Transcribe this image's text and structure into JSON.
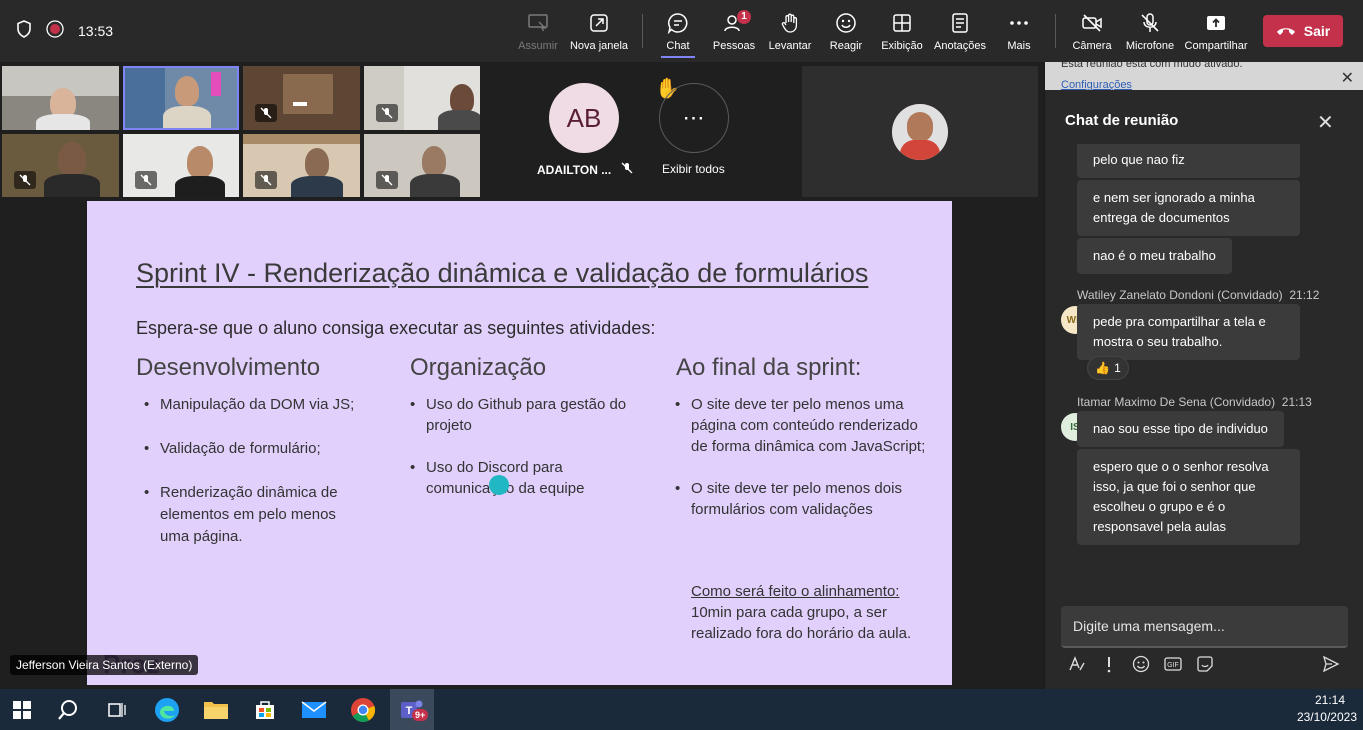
{
  "topbar": {
    "time": "13:53",
    "buttons": {
      "assumir": "Assumir",
      "nova_janela": "Nova janela",
      "chat": "Chat",
      "pessoas": "Pessoas",
      "pessoas_badge": "1",
      "levantar": "Levantar",
      "reagir": "Reagir",
      "exibicao": "Exibição",
      "anotacoes": "Anotações",
      "mais": "Mais",
      "camera": "Câmera",
      "microfone": "Microfone",
      "compartilhar": "Compartilhar",
      "sair": "Sair"
    }
  },
  "participants": {
    "ab_initials": "AB",
    "ab_name": "ADAILTON ...",
    "show_all": "Exibir todos"
  },
  "slide": {
    "title": "Sprint IV - Renderização dinâmica e validação de formulários",
    "intro": "Espera-se que o aluno consiga executar as seguintes atividades:",
    "col1": {
      "heading": "Desenvolvimento",
      "items": [
        "Manipulação da DOM via JS;",
        "Validação de formulário;",
        "Renderização dinâmica de elementos em pelo menos uma página."
      ]
    },
    "col2": {
      "heading": "Organização",
      "items": [
        "Uso do Github para gestão do projeto",
        "Uso do Discord para comunicação da equipe"
      ]
    },
    "col3": {
      "heading": "Ao final da sprint:",
      "items": [
        "O site deve ter pelo menos uma página com conteúdo renderizado de forma dinâmica com JavaScript;",
        "O site deve ter pelo menos dois formulários com validações"
      ],
      "alignment_title": "Como será feito o alinhamento:",
      "alignment_text": "10min para cada grupo, a ser realizado fora do horário da aula."
    },
    "presenter": "Jefferson Vieira Santos (Externo)"
  },
  "chat": {
    "banner_text": "Esta reunião está com mudo ativado.",
    "banner_link": "Configurações",
    "title": "Chat de reunião",
    "messages": [
      {
        "text": "pelo que nao fiz"
      },
      {
        "text": "e nem ser ignorado a minha entrega de documentos"
      },
      {
        "text": "nao é o meu trabalho"
      },
      {
        "sender": "Watiley Zanelato Dondoni (Convidado)",
        "time": "21:12",
        "initials": "WD",
        "text": "pede pra compartilhar a tela e mostra o seu trabalho."
      },
      {
        "sender": "Itamar Maximo De Sena (Convidado)",
        "time": "21:13",
        "initials": "IS",
        "text": "nao sou esse tipo de individuo"
      },
      {
        "text": "espero que o o senhor resolva isso, ja que foi o senhor que escolheu o grupo e é o responsavel pela aulas"
      }
    ],
    "reaction_count": "1",
    "compose_placeholder": "Digite uma mensagem..."
  },
  "taskbar": {
    "time": "21:14",
    "date": "23/10/2023",
    "teams_badge": "9+"
  },
  "colors": {
    "accent": "#7f85f5",
    "leave": "#c4314b",
    "slide_bg": "#e1d0fc"
  }
}
